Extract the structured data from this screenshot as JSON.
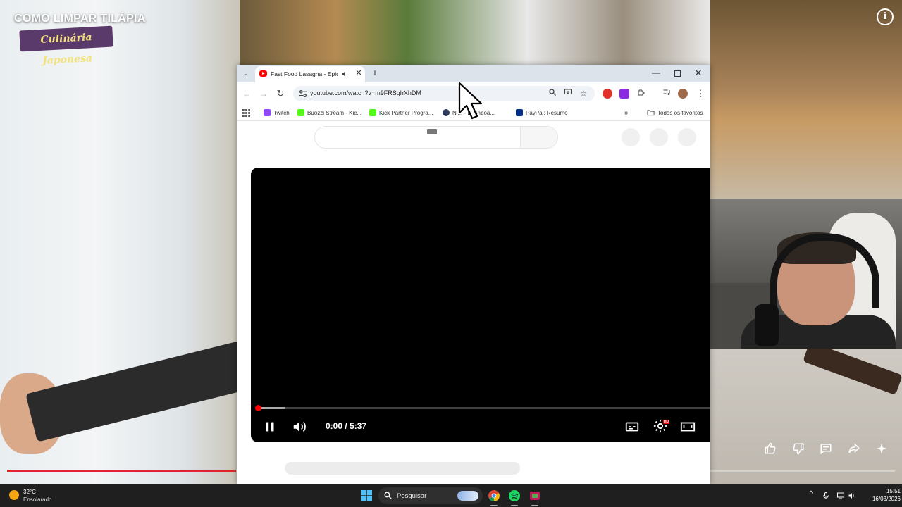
{
  "background_video": {
    "title": "COMO LIMPAR TILÁPIA",
    "logo_text": "Culinária Japonesa",
    "progress_fraction": 1.0
  },
  "chrome": {
    "tab_title": "Fast Food Lasagna - Epic M",
    "url": "youtube.com/watch?v=m9FRSghXhDM",
    "bookmarks": [
      "Twitch",
      "Buozzi Stream - Kic...",
      "Kick Partner Progra...",
      "Ni... - Dashboa...",
      "PayPal: Resumo"
    ],
    "all_bookmarks": "Todos os favoritos"
  },
  "player": {
    "time": "0:00 / 5:37",
    "buffered_fraction": 0.06,
    "hd_badge": "HD"
  },
  "taskbar": {
    "temperature": "32°C",
    "weather": "Ensolarado",
    "search_placeholder": "Pesquisar",
    "time": "15:51",
    "date": "16/03/2026"
  },
  "colors": {
    "youtube_red": "#ff0000",
    "progress_red": "#e0242f",
    "taskbar": "#1f1f1f"
  }
}
